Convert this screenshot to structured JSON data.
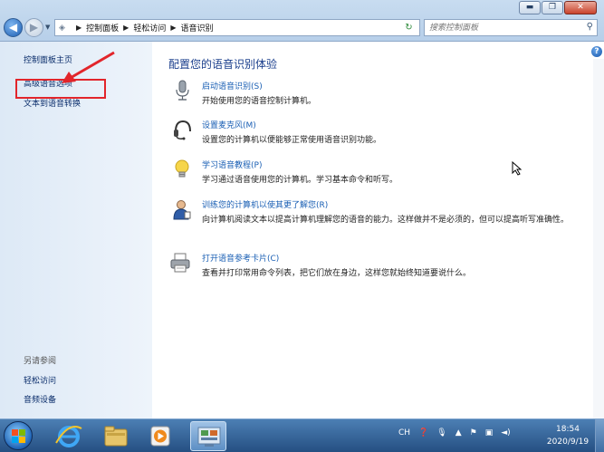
{
  "address_bar": {
    "breadcrumb": [
      "控制面板",
      "轻松访问",
      "语音识别"
    ]
  },
  "search": {
    "placeholder": "搜索控制面板"
  },
  "left_pane": {
    "links": [
      "控制面板主页",
      "高级语音选项",
      "文本到语音转换"
    ],
    "see_also_title": "另请参阅",
    "see_also": [
      "轻松访问",
      "音频设备"
    ]
  },
  "main": {
    "heading": "配置您的语音识别体验",
    "tasks": [
      {
        "title": "启动语音识别(S)",
        "desc": "开始使用您的语音控制计算机。",
        "icon": "microphone-icon"
      },
      {
        "title": "设置麦克风(M)",
        "desc": "设置您的计算机以便能够正常使用语音识别功能。",
        "icon": "headset-icon"
      },
      {
        "title": "学习语音教程(P)",
        "desc": "学习通过语音使用您的计算机。学习基本命令和听写。",
        "icon": "lightbulb-icon"
      },
      {
        "title": "训练您的计算机以使其更了解您(R)",
        "desc": "向计算机阅读文本以提高计算机理解您的语音的能力。这样做并不是必须的，但可以提高听写准确性。",
        "icon": "person-icon"
      },
      {
        "title": "打开语音参考卡片(C)",
        "desc": "查看并打印常用命令列表，把它们放在身边，这样您就始终知道要说什么。",
        "icon": "printer-icon"
      }
    ]
  },
  "taskbar": {
    "tray_lang": "CH",
    "clock_time": "18:54",
    "clock_date": "2020/9/19"
  },
  "colors": {
    "link": "#1a5fb4",
    "heading": "#1a3e8c",
    "highlight": "#e2252b"
  }
}
